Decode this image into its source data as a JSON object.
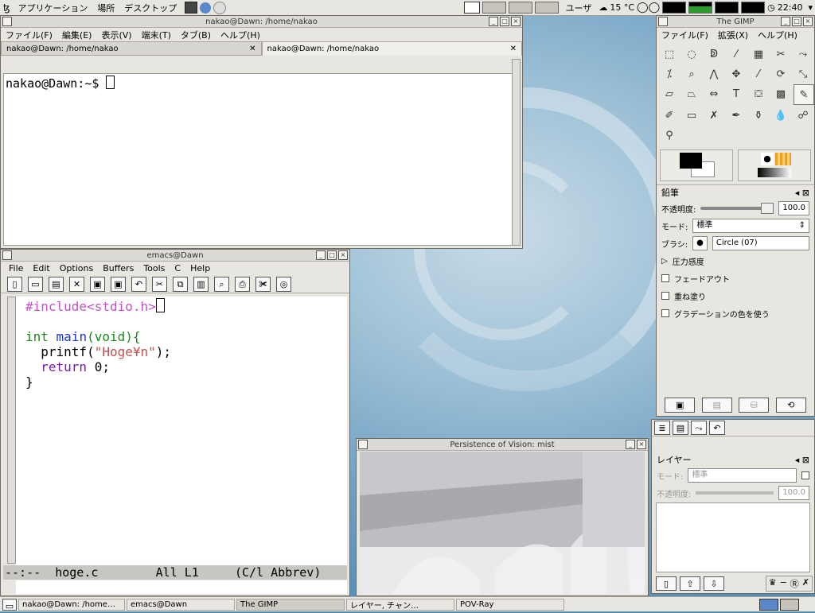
{
  "top_panel": {
    "menus": [
      "アプリケーション",
      "場所",
      "デスクトップ"
    ],
    "user": "ユーザ",
    "weather": "15 °C",
    "clock": "22:40"
  },
  "terminal": {
    "title": "nakao@Dawn: /home/nakao",
    "menus": [
      "ファイル(F)",
      "編集(E)",
      "表示(V)",
      "端末(T)",
      "タブ(B)",
      "ヘルプ(H)"
    ],
    "tabs": [
      {
        "label": "nakao@Dawn: /home/nakao",
        "close": "✕"
      },
      {
        "label": "nakao@Dawn: /home/nakao",
        "close": "✕"
      }
    ],
    "prompt": "nakao@Dawn:~$ "
  },
  "emacs": {
    "title": "emacs@Dawn",
    "menus": [
      "File",
      "Edit",
      "Options",
      "Buffers",
      "Tools",
      "C",
      "Help"
    ],
    "code": {
      "line1": "#include<stdio.h>",
      "line3_type": "int",
      "line3_fn": "main",
      "line3_rest": "(void){",
      "line4_a": "  printf(",
      "line4_str": "\"Hoge¥n\"",
      "line4_b": ");",
      "line5_kw": "return",
      "line5_rest": " 0;",
      "line6": "}"
    },
    "modeline": "--:--  hoge.c        All L1     (C/l Abbrev)"
  },
  "gimp": {
    "title": "The GIMP",
    "menus": [
      "ファイル(F)",
      "拡張(X)",
      "ヘルプ(H)"
    ],
    "options_title": "鉛筆",
    "opacity_label": "不透明度:",
    "opacity_value": "100.0",
    "mode_label": "モード:",
    "mode_value": "標準",
    "brush_label": "ブラシ:",
    "brush_value": "Circle (07)",
    "pressure": "圧力感度",
    "fade": "フェードアウト",
    "overlay": "重ね塗り",
    "gradient": "グラデーションの色を使う"
  },
  "layers": {
    "title": "レイヤー",
    "mode_label": "モード:",
    "mode_value": "標準",
    "opacity_label": "不透明度:",
    "opacity_value": "100.0"
  },
  "povray": {
    "title": "Persistence of Vision: mist"
  },
  "taskbar": {
    "items": [
      "nakao@Dawn: /home…",
      "emacs@Dawn",
      "The GIMP",
      "レイヤー, チャン…",
      "POV-Ray"
    ]
  }
}
